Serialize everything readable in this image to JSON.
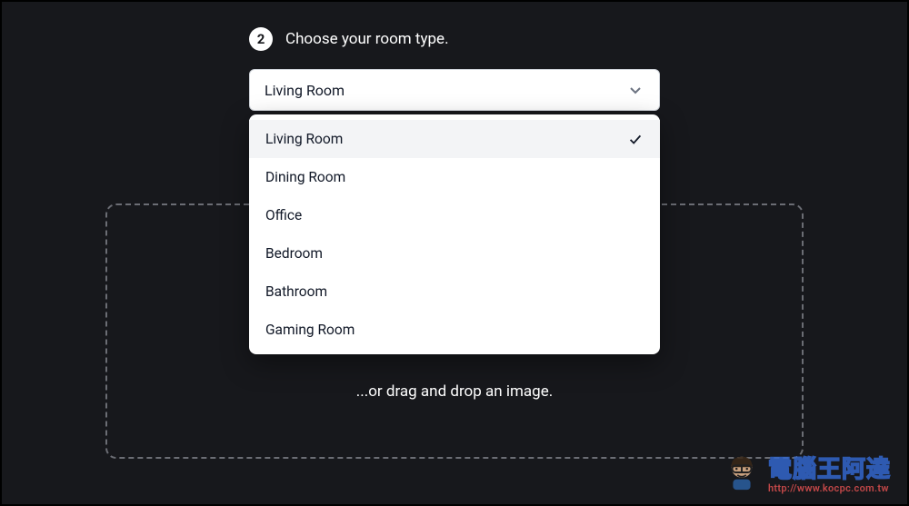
{
  "step": {
    "number": "2",
    "title": "Choose your room type."
  },
  "select": {
    "value": "Living Room",
    "options": [
      {
        "label": "Living Room",
        "selected": true
      },
      {
        "label": "Dining Room",
        "selected": false
      },
      {
        "label": "Office",
        "selected": false
      },
      {
        "label": "Bedroom",
        "selected": false
      },
      {
        "label": "Bathroom",
        "selected": false
      },
      {
        "label": "Gaming Room",
        "selected": false
      }
    ]
  },
  "dropzone": {
    "drag_text": "...or drag and drop an image."
  },
  "watermark": {
    "brand": "電腦王阿達",
    "url": "http://www.kocpc.com.tw"
  }
}
